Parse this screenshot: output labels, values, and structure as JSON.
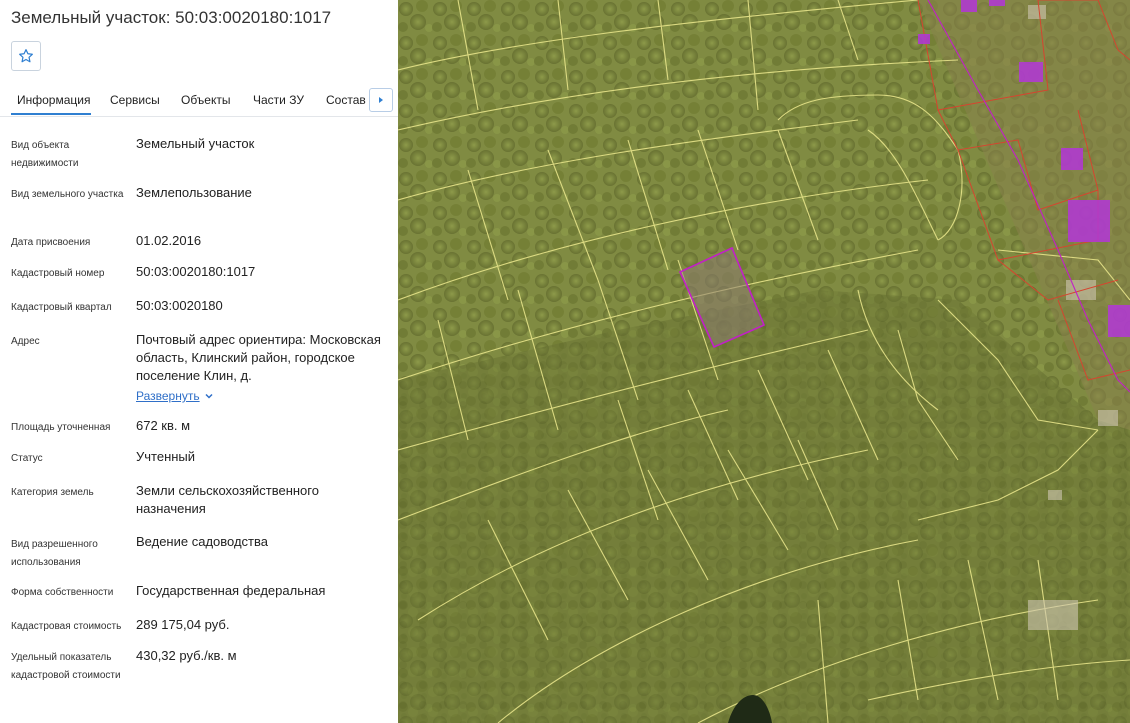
{
  "header": {
    "title": "Земельный участок: 50:03:0020180:1017"
  },
  "tabs": [
    {
      "label": "Информация",
      "active": true
    },
    {
      "label": "Сервисы"
    },
    {
      "label": "Объекты"
    },
    {
      "label": "Части ЗУ"
    },
    {
      "label": "Состав ЕЗП"
    }
  ],
  "fields": {
    "object_type": {
      "label": "Вид объекта недвижимости",
      "value": "Земельный участок"
    },
    "plot_type": {
      "label": "Вид земельного участка",
      "value": "Землепользование"
    },
    "assign_date": {
      "label": "Дата присвоения",
      "value": "01.02.2016"
    },
    "cadastral_number": {
      "label": "Кадастровый номер",
      "value": "50:03:0020180:1017"
    },
    "cadastral_block": {
      "label": "Кадастровый квартал",
      "value": "50:03:0020180"
    },
    "address": {
      "label": "Адрес",
      "value": "Почтовый адрес ориентира: Московская область, Клинский район, городское поселение Клин, д.",
      "expand_label": "Развернуть"
    },
    "area": {
      "label": "Площадь уточненная",
      "value": "672 кв. м"
    },
    "status": {
      "label": "Статус",
      "value": "Учтенный"
    },
    "land_category": {
      "label": "Категория земель",
      "value": "Земли сельскохозяйственного назначения"
    },
    "permitted_use": {
      "label": "Вид разрешенного использования",
      "value": "Ведение садоводства"
    },
    "ownership": {
      "label": "Форма собственности",
      "value": "Государственная федеральная"
    },
    "cadastral_value": {
      "label": "Кадастровая стоимость",
      "value": "289 175,04 руб."
    },
    "unit_value": {
      "label": "Удельный показатель кадастровой стоимости",
      "value": "430,32 руб./кв. м"
    }
  },
  "icons": {
    "favorite": "star-icon",
    "tabs_next": "chevron-right-icon",
    "expand": "chevron-down-icon"
  },
  "colors": {
    "accent": "#2f7fd1",
    "parcel_border": "#e7e48a",
    "selected_parcel": "#c21fc8",
    "neighbor_border": "#e0402e",
    "building": "#b336d8"
  }
}
